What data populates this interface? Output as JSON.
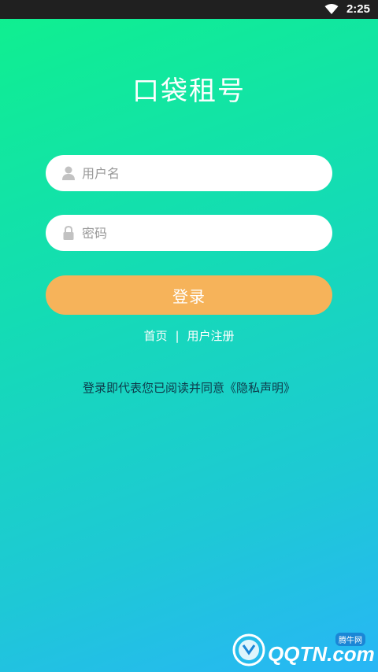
{
  "status_bar": {
    "time": "2:25"
  },
  "app": {
    "title": "口袋租号"
  },
  "form": {
    "username_placeholder": "用户名",
    "password_placeholder": "密码",
    "login_label": "登录"
  },
  "links": {
    "home": "首页",
    "separator": "|",
    "register": "用户注册"
  },
  "agreement": "登录即代表您已阅读并同意《隐私声明》",
  "watermark": {
    "brand": "QQTN.com",
    "tag": "腾牛网"
  },
  "icons": [
    "wifi-icon",
    "user-icon",
    "lock-icon"
  ],
  "colors": {
    "accent_button": "#f6b35a",
    "gradient_top": "#0ff08e",
    "gradient_bottom": "#28b6f6"
  }
}
